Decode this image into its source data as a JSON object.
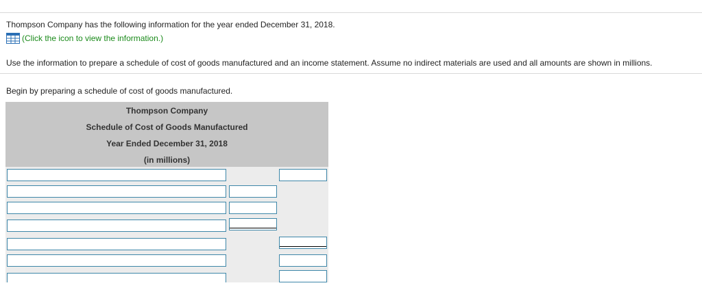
{
  "problem": {
    "intro_text": "Thompson Company has the following information for the year ended December 31, 2018.",
    "info_link_text": "(Click the icon to view the information.)",
    "info_icon": "table-grid-icon",
    "instructions_text": "Use the information to prepare a schedule of cost of goods manufactured and an income statement. Assume no indirect materials are used and all amounts are shown in millions.",
    "begin_text": "Begin by preparing a schedule of cost of goods manufactured."
  },
  "schedule": {
    "company": "Thompson Company",
    "title": "Schedule of Cost of Goods Manufactured",
    "period": "Year Ended December 31, 2018",
    "units": "(in millions)"
  },
  "colors": {
    "link_green": "#1a8a1a",
    "field_border": "#3d86a8",
    "header_gray": "#c6c6c6",
    "body_gray": "#ececec"
  }
}
